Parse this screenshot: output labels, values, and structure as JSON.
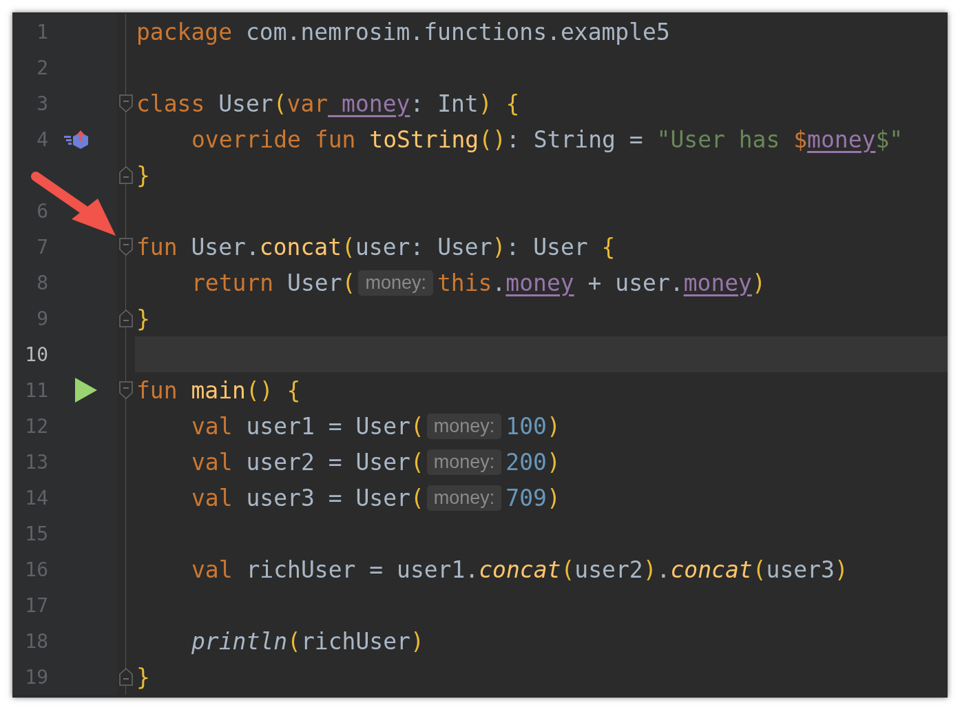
{
  "editor": {
    "lines": [
      {
        "number": "1",
        "current": false,
        "tokens": [
          {
            "kind": "keyword",
            "text": "package"
          },
          {
            "kind": "plain",
            "text": " com.nemrosim.functions.example5"
          }
        ]
      },
      {
        "number": "2",
        "current": false
      },
      {
        "number": "3",
        "current": false,
        "fold": {
          "kind": "start"
        },
        "tokens": [
          {
            "kind": "keyword",
            "text": "class"
          },
          {
            "kind": "plain",
            "text": " User"
          },
          {
            "kind": "brace",
            "text": "("
          },
          {
            "kind": "keyword",
            "text": "var"
          },
          {
            "kind": "property",
            "text": " money"
          },
          {
            "kind": "plain",
            "text": ": Int"
          },
          {
            "kind": "brace",
            "text": ")"
          },
          {
            "kind": "brace",
            "text": " {"
          }
        ],
        "children": [
          {
            "number": "4",
            "current": false,
            "gutter": {
              "kind": "implements"
            },
            "tokens": [
              {
                "kind": "keyword",
                "text": "override fun"
              },
              {
                "kind": "function",
                "text": " toString"
              },
              {
                "kind": "brace",
                "text": "()"
              },
              {
                "kind": "plain",
                "text": ": String = "
              },
              {
                "kind": "string",
                "text": "\"User has "
              },
              {
                "kind": "keyword",
                "text": "$"
              },
              {
                "kind": "property",
                "text": "money"
              },
              {
                "kind": "string",
                "text": "$\""
              }
            ]
          }
        ]
      },
      {
        "current": false,
        "fold": {
          "kind": "end"
        },
        "tokens": [
          {
            "kind": "brace",
            "text": "}"
          }
        ]
      },
      {
        "number": "6",
        "current": false
      },
      {
        "number": "7",
        "current": false,
        "fold": {
          "kind": "start"
        },
        "tokens": [
          {
            "kind": "keyword",
            "text": "fun"
          },
          {
            "kind": "plain",
            "text": " User."
          },
          {
            "kind": "function",
            "text": "concat"
          },
          {
            "kind": "brace",
            "text": "("
          },
          {
            "kind": "plain",
            "text": "user: User"
          },
          {
            "kind": "brace",
            "text": ")"
          },
          {
            "kind": "plain",
            "text": ": User "
          },
          {
            "kind": "brace",
            "text": "{"
          }
        ],
        "children": [
          {
            "number": "8",
            "current": false,
            "tokens": [
              {
                "kind": "keyword",
                "text": "return"
              },
              {
                "kind": "plain",
                "text": " User"
              },
              {
                "kind": "brace",
                "text": "("
              },
              {
                "kind": "hint",
                "text": "money:"
              },
              {
                "kind": "keyword",
                "text": "this"
              },
              {
                "kind": "plain",
                "text": "."
              },
              {
                "kind": "property",
                "text": "money"
              },
              {
                "kind": "plain",
                "text": " + user."
              },
              {
                "kind": "property",
                "text": "money"
              },
              {
                "kind": "brace",
                "text": ")"
              }
            ]
          }
        ]
      },
      {
        "number": "9",
        "current": false,
        "fold": {
          "kind": "end"
        },
        "tokens": [
          {
            "kind": "brace",
            "text": "}"
          }
        ]
      },
      {
        "number": "10",
        "current": true
      },
      {
        "number": "11",
        "current": false,
        "fold": {
          "kind": "start"
        },
        "gutter": {
          "kind": "run"
        },
        "tokens": [
          {
            "kind": "keyword",
            "text": "fun"
          },
          {
            "kind": "function",
            "text": " main"
          },
          {
            "kind": "brace",
            "text": "()"
          },
          {
            "kind": "brace",
            "text": " {"
          }
        ],
        "children": [
          {
            "number": "12",
            "current": false,
            "tokens": [
              {
                "kind": "keyword",
                "text": "val"
              },
              {
                "kind": "plain",
                "text": " user1 = User"
              },
              {
                "kind": "brace",
                "text": "("
              },
              {
                "kind": "hint",
                "text": "money:"
              },
              {
                "kind": "number",
                "text": "100"
              },
              {
                "kind": "brace",
                "text": ")"
              }
            ]
          },
          {
            "number": "13",
            "current": false,
            "tokens": [
              {
                "kind": "keyword",
                "text": "val"
              },
              {
                "kind": "plain",
                "text": " user2 = User"
              },
              {
                "kind": "brace",
                "text": "("
              },
              {
                "kind": "hint",
                "text": "money:"
              },
              {
                "kind": "number",
                "text": "200"
              },
              {
                "kind": "brace",
                "text": ")"
              }
            ]
          },
          {
            "number": "14",
            "current": false,
            "tokens": [
              {
                "kind": "keyword",
                "text": "val"
              },
              {
                "kind": "plain",
                "text": " user3 = User"
              },
              {
                "kind": "brace",
                "text": "("
              },
              {
                "kind": "hint",
                "text": "money:"
              },
              {
                "kind": "number",
                "text": "709"
              },
              {
                "kind": "brace",
                "text": ")"
              }
            ]
          },
          {
            "number": "15",
            "current": false
          },
          {
            "number": "16",
            "current": false,
            "tokens": [
              {
                "kind": "keyword",
                "text": "val"
              },
              {
                "kind": "plain",
                "text": " richUser = user1."
              },
              {
                "kind": "extension",
                "text": "concat"
              },
              {
                "kind": "brace",
                "text": "("
              },
              {
                "kind": "plain",
                "text": "user2"
              },
              {
                "kind": "brace",
                "text": ")"
              },
              {
                "kind": "plain",
                "text": "."
              },
              {
                "kind": "extension",
                "text": "concat"
              },
              {
                "kind": "brace",
                "text": "("
              },
              {
                "kind": "plain",
                "text": "user3"
              },
              {
                "kind": "brace",
                "text": ")"
              }
            ]
          },
          {
            "number": "17",
            "current": false
          },
          {
            "number": "18",
            "current": false,
            "tokens": [
              {
                "kind": "library",
                "text": "println"
              },
              {
                "kind": "brace",
                "text": "("
              },
              {
                "kind": "plain",
                "text": "richUser"
              },
              {
                "kind": "brace",
                "text": ")"
              }
            ]
          }
        ]
      },
      {
        "number": "19",
        "current": false,
        "fold": {
          "kind": "end"
        },
        "tokens": [
          {
            "kind": "brace",
            "text": "}"
          }
        ]
      }
    ]
  }
}
